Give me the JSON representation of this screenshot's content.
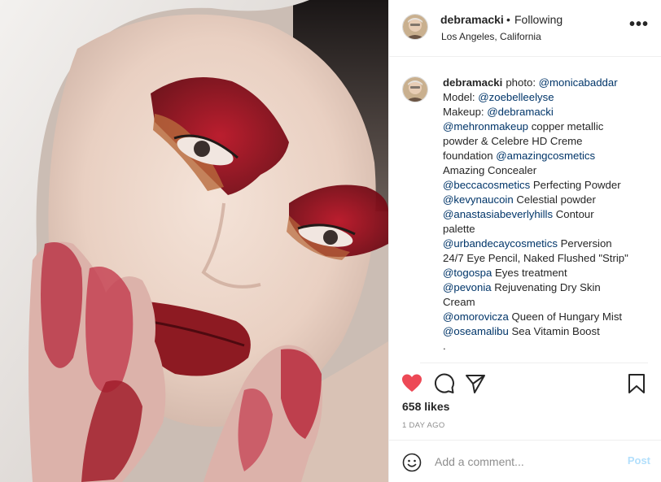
{
  "header": {
    "username": "debramacki",
    "separator": "•",
    "follow_status": "Following",
    "location": "Los Angeles, California",
    "more_icon": "more-horizontal-icon"
  },
  "caption": {
    "username": "debramacki",
    "lines": [
      [
        {
          "t": "photo: "
        },
        {
          "t": "@monicabaddar",
          "link": true
        }
      ],
      [
        {
          "t": "Model: "
        },
        {
          "t": "@zoebelleelyse",
          "link": true
        }
      ],
      [
        {
          "t": "Makeup: "
        },
        {
          "t": "@debramacki",
          "link": true
        }
      ],
      [
        {
          "t": "@mehronmakeup",
          "link": true
        },
        {
          "t": " copper metallic"
        }
      ],
      [
        {
          "t": "powder & Celebre HD Creme"
        }
      ],
      [
        {
          "t": "foundation "
        },
        {
          "t": "@amazingcosmetics",
          "link": true
        }
      ],
      [
        {
          "t": "Amazing Concealer"
        }
      ],
      [
        {
          "t": "@beccacosmetics",
          "link": true
        },
        {
          "t": " Perfecting Powder"
        }
      ],
      [
        {
          "t": "@kevynaucoin",
          "link": true
        },
        {
          "t": " Celestial powder"
        }
      ],
      [
        {
          "t": "@anastasiabeverlyhills",
          "link": true
        },
        {
          "t": " Contour"
        }
      ],
      [
        {
          "t": "palette"
        }
      ],
      [
        {
          "t": "@urbandecaycosmetics",
          "link": true
        },
        {
          "t": " Perversion"
        }
      ],
      [
        {
          "t": "24/7 Eye Pencil, Naked Flushed \"Strip\""
        }
      ],
      [
        {
          "t": "@togospa",
          "link": true
        },
        {
          "t": " Eyes treatment"
        }
      ],
      [
        {
          "t": "@pevonia",
          "link": true
        },
        {
          "t": " Rejuvenating Dry Skin"
        }
      ],
      [
        {
          "t": "Cream"
        }
      ],
      [
        {
          "t": "@omorovicza",
          "link": true
        },
        {
          "t": " Queen of Hungary Mist"
        }
      ],
      [
        {
          "t": "@oseamalibu",
          "link": true
        },
        {
          "t": " Sea Vitamin Boost"
        }
      ],
      [
        {
          "t": "."
        }
      ]
    ]
  },
  "actions": {
    "like_icon": "heart-filled-icon",
    "comment_icon": "comment-icon",
    "share_icon": "share-icon",
    "save_icon": "bookmark-icon",
    "like_color": "#ed4956"
  },
  "likes": "658 likes",
  "date": "1 DAY AGO",
  "comment": {
    "placeholder": "Add a comment...",
    "post_label": "Post",
    "emoji_icon": "emoji-icon"
  },
  "colors": {
    "link": "#003569",
    "text": "#262626",
    "muted": "#8e8e8e",
    "border": "#efefef",
    "post_disabled": "#b2dffc"
  }
}
